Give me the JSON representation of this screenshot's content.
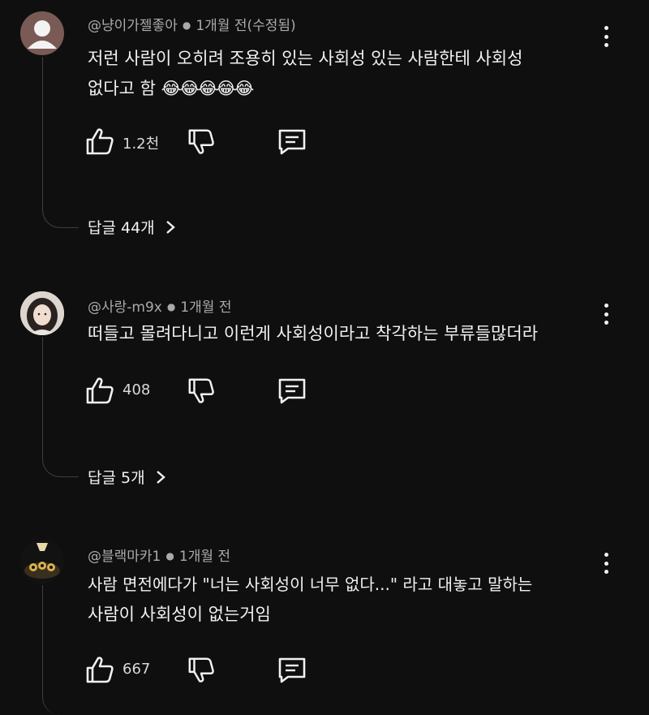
{
  "comments": [
    {
      "author": "@냥이가젤좋아",
      "time": "1개월 전(수정됨)",
      "line1": "저런 사람이 오히려 조용히 있는 사회성 있는 사람한테 사회성",
      "line2": "없다고 함",
      "emoji": "😂😂😂😂😂",
      "likes": "1.2천",
      "replies": "답글 44개",
      "avatar": "default-avatar-icon"
    },
    {
      "author": "@사랑-m9x",
      "time": "1개월 전",
      "line1": "떠들고 몰려다니고 이런게 사회성이라고 착각하는 부류들많더라",
      "likes": "408",
      "replies": "답글 5개",
      "avatar": "photo-avatar"
    },
    {
      "author": "@블랙마카1",
      "time": "1개월 전",
      "line1": "사람 면전에다가 \"너는 사회성이 너무 없다...\" 라고 대놓고 말하는",
      "line2": "사람이 사회성이 없는거임",
      "likes": "667",
      "avatar": "photo-avatar"
    }
  ],
  "colors": {
    "background": "#0f0f0f",
    "text": "#f1f1f1",
    "meta": "#aaaaaa",
    "thread": "#3f3f3f"
  }
}
